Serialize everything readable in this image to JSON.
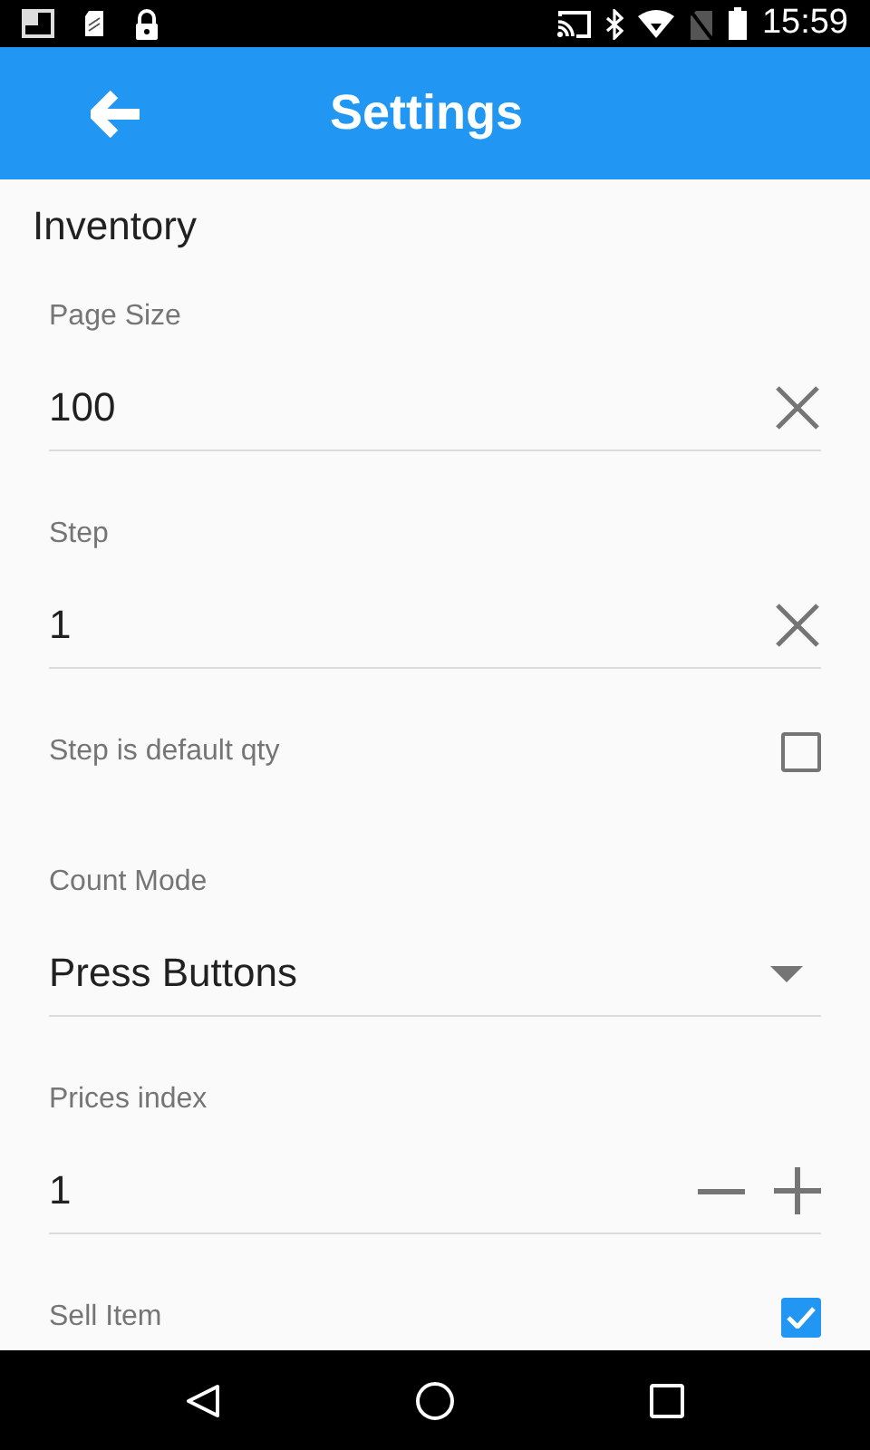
{
  "status_bar": {
    "time": "15:59"
  },
  "app_bar": {
    "title": "Settings"
  },
  "section": {
    "title": "Inventory"
  },
  "settings": [
    {
      "kind": "text",
      "label": "Page Size",
      "value": "100"
    },
    {
      "kind": "text",
      "label": "Step",
      "value": "1"
    },
    {
      "kind": "checkbox",
      "label": "Step is default qty",
      "checked": false
    },
    {
      "kind": "dropdown",
      "label": "Count Mode",
      "value": "Press Buttons"
    },
    {
      "kind": "stepper",
      "label": "Prices index",
      "value": "1"
    },
    {
      "kind": "checkbox",
      "label": "Sell Item",
      "checked": true
    }
  ]
}
